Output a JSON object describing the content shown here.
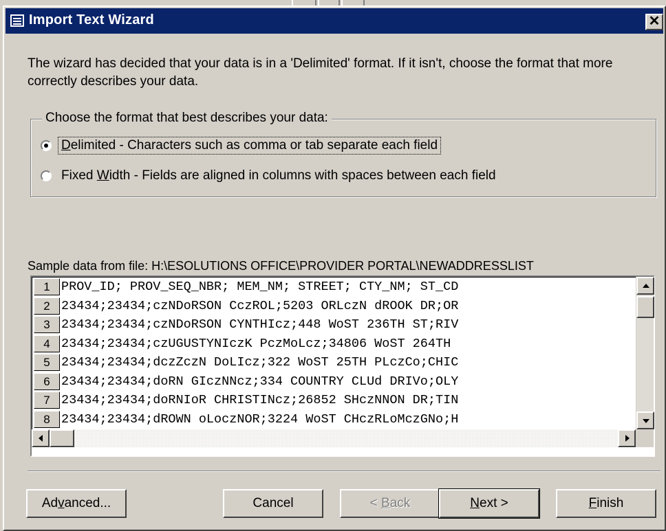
{
  "window": {
    "title": "Import Text Wizard",
    "close_glyph": "✕"
  },
  "description": "The wizard has decided that your data is in a 'Delimited' format.  If it isn't, choose the format that more correctly describes your data.",
  "format_group": {
    "legend": "Choose the format that best describes your data:",
    "options": [
      {
        "mnemonic": "D",
        "label_rest": "elimited - Characters such as comma or tab separate each field",
        "selected": true
      },
      {
        "label_prefix": "Fixed ",
        "mnemonic": "W",
        "label_rest": "idth - Fields are aligned in columns with spaces between each field",
        "selected": false
      }
    ]
  },
  "sample": {
    "label": "Sample data from file: H:\\ESOLUTIONS OFFICE\\PROVIDER PORTAL\\NEWADDRESSLIST",
    "rows": [
      {
        "num": "1",
        "text": "PROV_ID; PROV_SEQ_NBR; MEM_NM; STREET; CTY_NM; ST_CD"
      },
      {
        "num": "2",
        "text": "23434;23434;czNDoRSON CczROL;5203 ORLczN dROOK DR;OR"
      },
      {
        "num": "3",
        "text": "23434;23434;czNDoRSON CYNTHIcz;448 WoST 236TH ST;RIV"
      },
      {
        "num": "4",
        "text": "23434;23434;czUGUSTYNIczK PczMoLcz;34806 WoST 264TH"
      },
      {
        "num": "5",
        "text": "23434;23434;dczZczN DoLIcz;322 WoST 25TH PLczCo;CHIC"
      },
      {
        "num": "6",
        "text": "23434;23434;doRN GIczNNcz;334 COUNTRY CLUd DRIVo;OLY"
      },
      {
        "num": "7",
        "text": "23434;23434;doRNIoR CHRISTINcz;26852 SHczNNON DR;TIN"
      },
      {
        "num": "8",
        "text": "23434;23434;dROWN oLoczNOR;3224 WoST CHczRLoMczGNo;H"
      }
    ]
  },
  "buttons": {
    "advanced": {
      "pre": "Ad",
      "mn": "v",
      "post": "anced..."
    },
    "cancel": {
      "pre": "Cancel",
      "mn": "",
      "post": ""
    },
    "back": {
      "pre": "< ",
      "mn": "B",
      "post": "ack"
    },
    "next": {
      "pre": "",
      "mn": "N",
      "post": "ext >"
    },
    "finish": {
      "pre": "",
      "mn": "F",
      "post": "inish"
    }
  }
}
